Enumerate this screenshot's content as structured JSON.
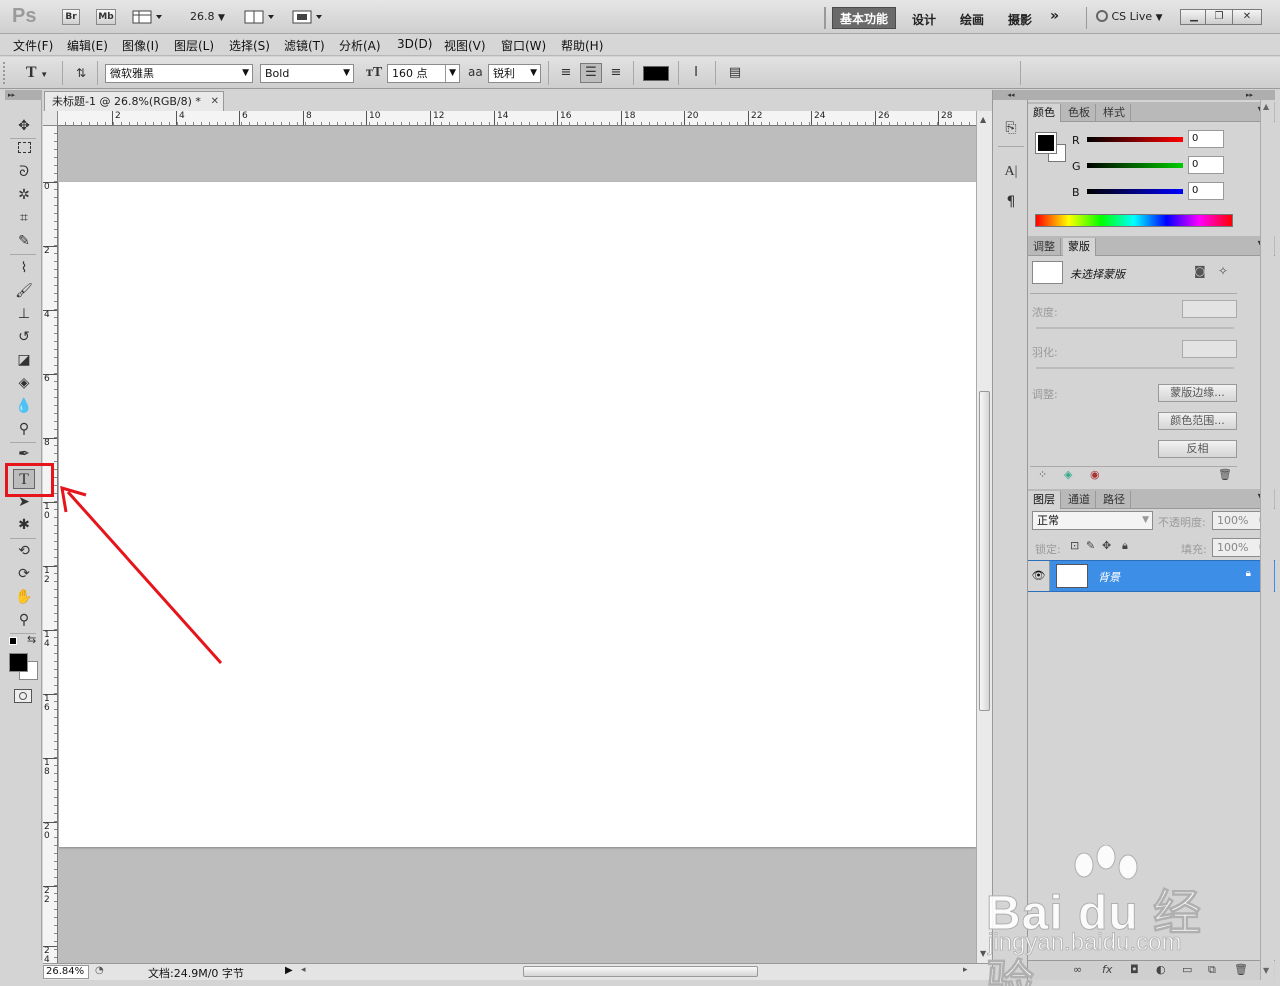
{
  "appbar": {
    "logo": "Ps",
    "bridge": "Br",
    "minibridge": "Mb",
    "zoom": "26.8",
    "workspaces": [
      "基本功能",
      "设计",
      "绘画",
      "摄影"
    ],
    "more": "»",
    "cslive": "CS Live",
    "window_controls": [
      "minimize",
      "restore",
      "close"
    ]
  },
  "menu": [
    "文件(F)",
    "编辑(E)",
    "图像(I)",
    "图层(L)",
    "选择(S)",
    "滤镜(T)",
    "分析(A)",
    "3D(D)",
    "视图(V)",
    "窗口(W)",
    "帮助(H)"
  ],
  "options": {
    "tool_glyph": "T",
    "font_family": "微软雅黑",
    "font_style": "Bold",
    "font_size": "160 点",
    "aa_label": "aa",
    "antialias": "锐利",
    "text_color": "#000000"
  },
  "document": {
    "tab_title": "未标题-1 @ 26.8%(RGB/8) *",
    "hruler_ticks": [
      "2",
      "4",
      "6",
      "8",
      "10",
      "12",
      "14",
      "16",
      "18",
      "20",
      "22",
      "24",
      "26",
      "28"
    ],
    "vruler_ticks": [
      "0",
      "2",
      "4",
      "6",
      "8",
      "1\n0",
      "1\n2",
      "1\n4",
      "1\n6",
      "1\n8",
      "2\n0",
      "2\n2",
      "2\n4"
    ],
    "zoom": "26.84%",
    "doc_info": "文档:24.9M/0 字节"
  },
  "color_panel": {
    "tabs": [
      "颜色",
      "色板",
      "样式"
    ],
    "channels": [
      {
        "label": "R",
        "value": "0",
        "color": "#cc0000"
      },
      {
        "label": "G",
        "value": "0",
        "color": "#00aa00"
      },
      {
        "label": "B",
        "value": "0",
        "color": "#0000cc"
      }
    ]
  },
  "masks_panel": {
    "tabs": [
      "调整",
      "蒙版"
    ],
    "no_mask": "未选择蒙版",
    "density": "浓度:",
    "feather": "羽化:",
    "refine": "调整:",
    "buttons": [
      "蒙版边缘...",
      "颜色范围...",
      "反相"
    ]
  },
  "layers_panel": {
    "tabs": [
      "图层",
      "通道",
      "路径"
    ],
    "blend_mode": "正常",
    "opacity_label": "不透明度:",
    "opacity": "100%",
    "lock_label": "锁定:",
    "fill_label": "填充:",
    "fill": "100%",
    "layer_name": "背景"
  },
  "watermark": {
    "main": "Bai du 经验",
    "url": "jingyan.baidu.com"
  },
  "annotation": {
    "color": "#e6141b"
  }
}
